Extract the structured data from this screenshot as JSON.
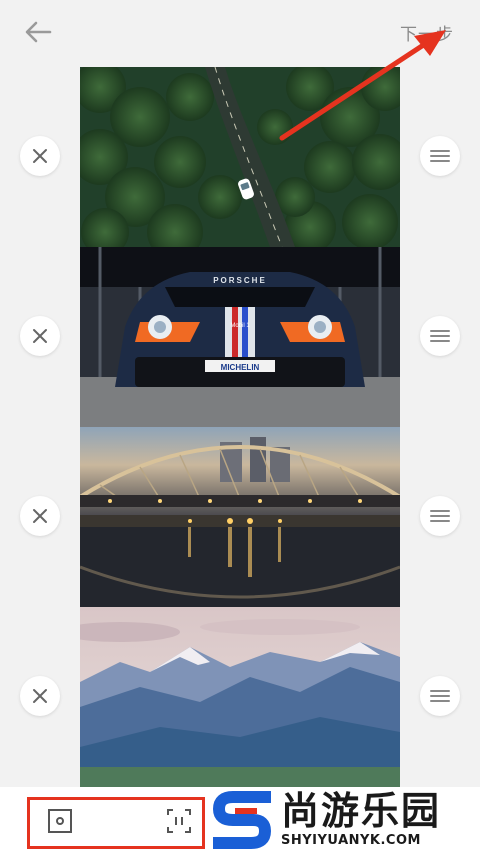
{
  "header": {
    "back_icon": "arrow-left-icon",
    "next_label": "下一步"
  },
  "photos": [
    {
      "name": "aerial-forest-road",
      "remove_icon": "close-icon",
      "drag_icon": "drag-handle-icon"
    },
    {
      "name": "porsche-race-car",
      "remove_icon": "close-icon",
      "drag_icon": "drag-handle-icon"
    },
    {
      "name": "bridge-night-reflection",
      "remove_icon": "close-icon",
      "drag_icon": "drag-handle-icon"
    },
    {
      "name": "mountain-landscape",
      "remove_icon": "close-icon",
      "drag_icon": "drag-handle-icon"
    }
  ],
  "car_text": {
    "brand": "PORSCHE",
    "plate": "MICHELIN",
    "sponsor": "Mobil 1"
  },
  "toolbar": {
    "tool1_icon": "frame-icon",
    "tool2_icon": "aspect-ratio-icon"
  },
  "watermark": {
    "name": "尚游乐园",
    "url": "SHYIYUANYK.COM"
  },
  "colors": {
    "annotation_red": "#e5331f",
    "logo_blue": "#1a5fd6"
  }
}
